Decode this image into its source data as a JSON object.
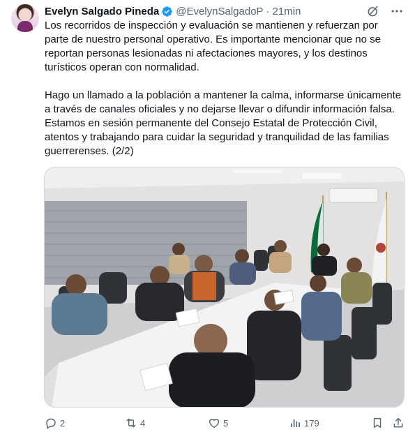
{
  "author": {
    "name": "Evelyn Salgado Pineda",
    "handle": "@EvelynSalgadoP",
    "separator": "·",
    "time": "21min"
  },
  "body": {
    "paragraph1": "Los recorridos de inspección y evaluación se mantienen y refuerzan por parte de nuestro personal operativo. Es importante mencionar que no se reportan personas lesionadas ni afectaciones mayores, y los destinos turísticos operan con normalidad.",
    "paragraph2": "Hago un llamado a la población a mantener la calma, informarse únicamente a través de canales oficiales y no dejarse llevar o difundir información falsa. Estamos en sesión permanente del Consejo Estatal de Protección Civil, atentos y trabajando para cuidar la seguridad y tranquilidad de las familias guerrerenses. (2/2)"
  },
  "actions": {
    "replies": "2",
    "reposts": "4",
    "likes": "5",
    "views": "179"
  },
  "icons": {
    "verified": "verified-badge-icon",
    "grok": "grok-icon",
    "more": "more-icon",
    "reply": "reply-icon",
    "repost": "repost-icon",
    "like": "like-icon",
    "views": "views-icon",
    "bookmark": "bookmark-icon",
    "share": "share-icon"
  },
  "colors": {
    "text": "#0f1419",
    "secondary": "#536471",
    "verified": "#1d9bf0"
  }
}
